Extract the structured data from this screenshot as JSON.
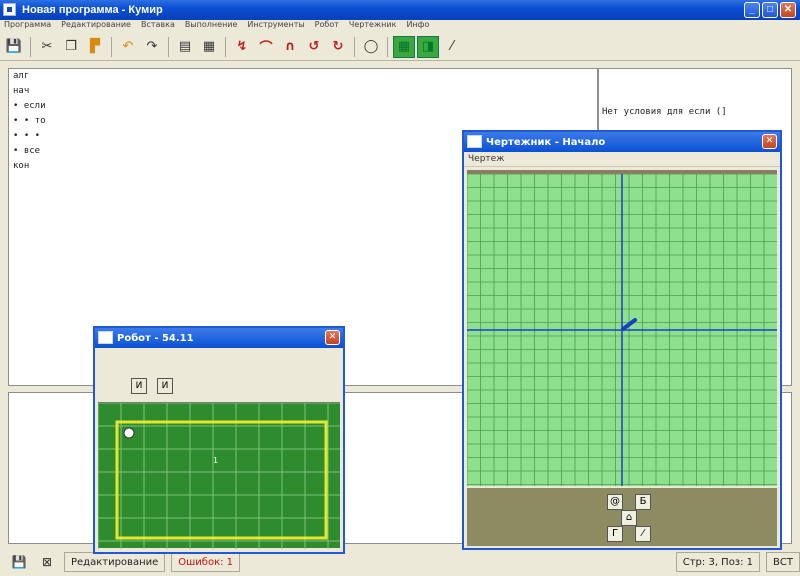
{
  "main_window": {
    "title": "Новая программа - Кумир",
    "buttons": {
      "minimize": "_",
      "maximize": "□",
      "close": "✕"
    }
  },
  "menu": [
    "Программа",
    "Редактирование",
    "Вставка",
    "Выполнение",
    "Инструменты",
    "Робот",
    "Чертежник",
    "Инфо"
  ],
  "toolbar": {
    "icons": [
      "save-icon",
      "cut-icon",
      "copy-icon",
      "paste-icon",
      "undo-icon",
      "redo-icon",
      "compile-icon",
      "run-icon",
      "step-icon",
      "step-in-icon",
      "step-out-icon",
      "stop-icon",
      "pause-icon",
      "robot-icon",
      "drawer-icon",
      "pen-icon"
    ]
  },
  "editor": {
    "lines": [
      "алг",
      "нач",
      "• если",
      "•  • то",
      "•  • •",
      "• все",
      "кон"
    ]
  },
  "margin": {
    "message": "Нет условия для если  (]"
  },
  "statusbar": {
    "mode": "Редактирование",
    "errors": "Ошибок: 1",
    "position": "Стр: 3, Поз: 1",
    "ins": "ВСТ"
  },
  "robot_window": {
    "title": "Робот - 54.11",
    "tool_labels": [
      "И",
      "И"
    ],
    "cell_label": "1"
  },
  "draw_window": {
    "title": "Чертежник - Начало",
    "menu": [
      "Чертеж"
    ],
    "pad_labels": [
      "@",
      "Б",
      "Г",
      "⁄"
    ]
  },
  "colors": {
    "robot_field": "#2e8b2e",
    "robot_wall": "#e6e62e",
    "drawing_canvas": "#8ee08e",
    "axis": "#1a3ec8",
    "error": "#c81010"
  }
}
